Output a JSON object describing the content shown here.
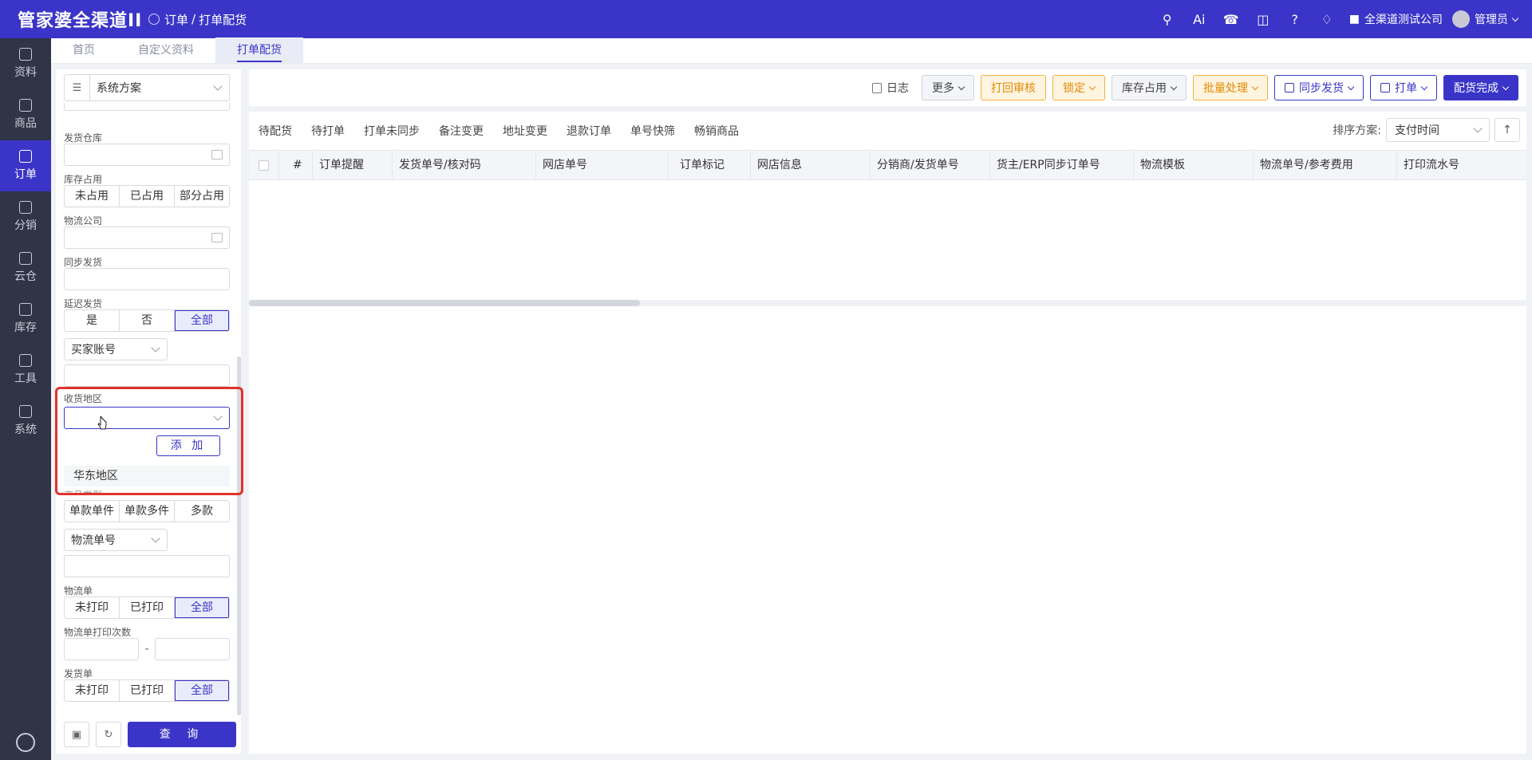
{
  "app": {
    "logo": "管家婆全渠道II"
  },
  "breadcrumb": {
    "parent": "订单",
    "separator": "/",
    "current": "打单配货"
  },
  "topbar": {
    "company": "全渠道测试公司",
    "user": "管理员"
  },
  "leftnav": {
    "items": [
      {
        "label": "资料",
        "icon": "layers-icon"
      },
      {
        "label": "商品",
        "icon": "box-icon"
      },
      {
        "label": "订单",
        "icon": "document-icon",
        "active": true
      },
      {
        "label": "分销",
        "icon": "network-icon"
      },
      {
        "label": "云仓",
        "icon": "cloud-house-icon"
      },
      {
        "label": "库存",
        "icon": "stack-icon"
      },
      {
        "label": "工具",
        "icon": "toolbox-icon"
      },
      {
        "label": "系统",
        "icon": "monitor-icon"
      }
    ]
  },
  "tabs": [
    {
      "label": "首页"
    },
    {
      "label": "自定义资料"
    },
    {
      "label": "打单配货",
      "active": true
    }
  ],
  "filter": {
    "scheme": "系统方案",
    "warehouse_label": "发货仓库",
    "stock_label": "库存占用",
    "stock_options": [
      "未占用",
      "已占用",
      "部分占用"
    ],
    "logistics_company_label": "物流公司",
    "sync_ship_label": "同步发货",
    "delay_label": "延迟发货",
    "delay_options": [
      "是",
      "否",
      "全部"
    ],
    "buyer_select": "买家账号",
    "region_label": "收货地区",
    "add_button": "添 加",
    "region_option": "华东地区",
    "goods_type_options": [
      "单款单件",
      "单款多件",
      "多款"
    ],
    "logistics_no_select": "物流单号",
    "waybill_label": "物流单",
    "waybill_options": [
      "未打印",
      "已打印",
      "全部"
    ],
    "waybill_print_count_label": "物流单打印次数",
    "range_dash": "-",
    "ship_doc_label": "发货单",
    "ship_doc_options": [
      "未打印",
      "已打印",
      "全部"
    ],
    "query_button": "查 询"
  },
  "toolbar": {
    "log": "日志",
    "more": "更多",
    "return_review": "打回审核",
    "lock": "锁定",
    "stock_occupy": "库存占用",
    "batch": "批量处理",
    "sync_ship": "同步发货",
    "print": "打单",
    "done": "配货完成"
  },
  "subtabs": [
    "待配货",
    "待打单",
    "打单未同步",
    "备注变更",
    "地址变更",
    "退款订单",
    "单号快筛",
    "畅销商品"
  ],
  "sort": {
    "label": "排序方案:",
    "value": "支付时间"
  },
  "table": {
    "columns": [
      "#",
      "订单提醒",
      "发货单号/核对码",
      "网店单号",
      "订单标记",
      "网店信息",
      "分销商/发货单号",
      "货主/ERP同步订单号",
      "物流模板",
      "物流单号/参考费用",
      "打印流水号"
    ]
  },
  "colors": {
    "brand": "#3a35c8",
    "nav_bg": "#2f3447",
    "highlight": "#e0332c",
    "orange": "#e38a00"
  }
}
